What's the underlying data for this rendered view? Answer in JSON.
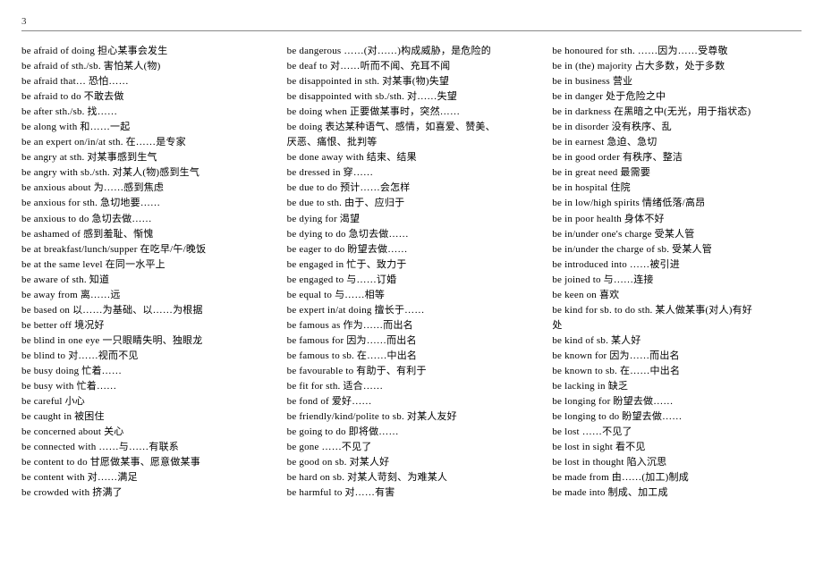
{
  "page_number": "3",
  "columns": [
    [
      "be afraid of doing  担心某事会发生",
      "be afraid of sth./sb.  害怕某人(物)",
      "be afraid that…  恐怕……",
      "be afraid to do  不敢去做",
      "be after sth./sb.  找……",
      "be along with  和……一起",
      "be an expert on/in/at sth.  在……是专家",
      "be angry at sth.  对某事感到生气",
      "be angry with sb./sth.  对某人(物)感到生气",
      "be anxious about  为……感到焦虑",
      "be anxious for sth.  急切地要……",
      "be anxious to do  急切去做……",
      "be ashamed of  感到羞耻、惭愧",
      "be at breakfast/lunch/supper  在吃早/午/晚饭",
      "be at the same level  在同一水平上",
      "be aware of sth.  知道",
      "be away from  离……远",
      "be based on 以……为基础、以……为根据",
      "be better off 境况好",
      "be blind in one eye  一只眼睛失明、独眼龙",
      "be blind to  对……视而不见",
      "be busy doing  忙着……",
      "be busy with 忙着……",
      "be careful  小心",
      "be caught in 被困住",
      "be concerned about  关心",
      "be connected with  ……与……有联系",
      "be content to do  甘愿做某事、愿意做某事",
      "be content with  对……满足",
      "be crowded with  挤满了"
    ],
    [
      "be dangerous ……(对……)构成威胁，是危险的",
      "be deaf to  对……听而不闻、充耳不闻",
      "be disappointed in sth.  对某事(物)失望",
      "be disappointed with sb./sth.  对……失望",
      "be doing when  正要做某事时，突然……",
      "be doing  表达某种语气、感情，如喜爱、赞美、",
      "厌恶、痛恨、批判等",
      "be done away with  结束、结果",
      "be dressed in 穿……",
      "be due to do 预计……会怎样",
      "be due to sth.  由于、应归于",
      "be dying for 渴望",
      "be dying to do 急切去做……",
      "be eager to do 盼望去做……",
      "be engaged in  忙于、致力于",
      "be engaged to  与……订婚",
      "be equal to 与……相等",
      "be expert in/at doing 擅长于……",
      "be famous as 作为……而出名",
      "be famous for  因为……而出名",
      "be famous to sb.  在……中出名",
      "be favourable to  有助于、有利于",
      "be fit for sth. 适合……",
      "be fond of  爱好……",
      "be friendly/kind/polite to sb.  对某人友好",
      "be going to do  即将做……",
      "be gone ……不见了",
      "be good on sb.  对某人好",
      "be hard on sb.  对某人苛刻、为难某人",
      "be harmful to  对……有害"
    ],
    [
      "be honoured for sth.  ……因为……受尊敬",
      "be in (the) majority  占大多数，处于多数",
      "be in business  营业",
      "be in danger 处于危险之中",
      "be in darkness  在黑暗之中(无光，用于指状态)",
      "be in disorder  没有秩序、乱",
      "be in earnest 急迫、急切",
      "be in good order  有秩序、整洁",
      "be in great need  最需要",
      "be in hospital  住院",
      "be in low/high spirits  情绪低落/高昂",
      "be in poor health  身体不好",
      "be in/under one's charge  受某人管",
      "be in/under the charge of sb. 受某人管",
      "be introduced into ……被引进",
      "be joined to  与……连接",
      "be keen on  喜欢",
      "be kind for sb. to do sth. 某人做某事(对人)有好",
      "处",
      "be kind of sb.  某人好",
      "be known for  因为……而出名",
      "be known to sb.  在……中出名",
      "be lacking in 缺乏",
      "be longing for  盼望去做……",
      "be longing to do  盼望去做……",
      "be lost ……不见了",
      "be lost in sight 看不见",
      "be lost in thought  陷入沉思",
      "be made from  由……(加工)制成",
      "be made into 制成、加工成"
    ]
  ]
}
